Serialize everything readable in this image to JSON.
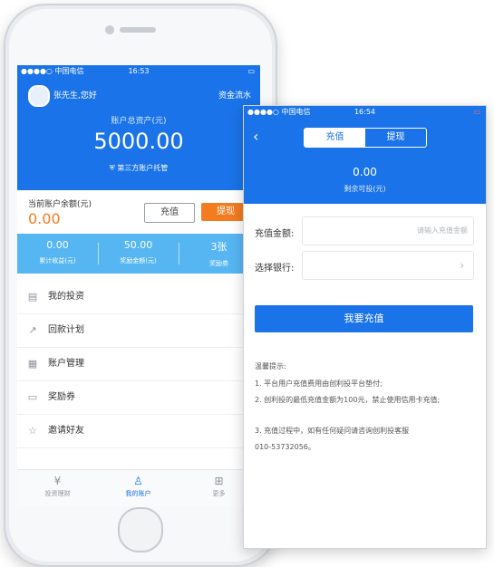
{
  "left_phone": {
    "status": {
      "carrier": "●●●●○ 中国电信",
      "time": "16:53",
      "battery": "▬"
    },
    "header": {
      "greeting": "张先生,您好",
      "fund_flow": "资金流水",
      "total_label": "账户总资产(元)",
      "total_value": "5000.00",
      "trustee": "第三方账户托管"
    },
    "balance": {
      "label": "当前账户余额(元)",
      "value": "0.00"
    },
    "buttons": {
      "recharge": "充值",
      "withdraw": "提现"
    },
    "stats": [
      {
        "value": "0.00",
        "label": "累计收益(元)"
      },
      {
        "value": "50.00",
        "label": "奖励金额(元)"
      },
      {
        "value": "3张",
        "label": "奖励券"
      }
    ],
    "menu": [
      {
        "label": "我的投资",
        "icon": "investment-icon"
      },
      {
        "label": "回款计划",
        "icon": "plan-icon"
      },
      {
        "label": "账户管理",
        "icon": "account-icon"
      },
      {
        "label": "奖励券",
        "icon": "coupon-icon"
      },
      {
        "label": "邀请好友",
        "icon": "invite-icon"
      }
    ],
    "tabs": [
      {
        "label": "投资理财",
        "icon": "yen-icon"
      },
      {
        "label": "我的账户",
        "icon": "user-icon"
      },
      {
        "label": "更多",
        "icon": "grid-icon"
      }
    ]
  },
  "right_panel": {
    "status": {
      "carrier": "●●●●○ 中国电信",
      "time": "16:54"
    },
    "segments": {
      "recharge": "充值",
      "withdraw": "提现"
    },
    "amount": "0.00",
    "amount_label": "剩余可投(元)",
    "form": {
      "amount_label": "充值金额:",
      "amount_placeholder": "请输入充值金额",
      "bank_label": "选择银行:"
    },
    "submit": "我要充值",
    "tips": {
      "title": "温馨提示:",
      "items": [
        "1. 平台用户充值费用由创利投平台垫付;",
        "2. 创利投的最低充值金额为100元，禁止使用信用卡充值;",
        "3. 充值过程中，如有任何疑问请咨询创利投客服",
        "010-53732056。"
      ]
    }
  },
  "colors": {
    "primary": "#1a73e8",
    "accent": "#f47b20",
    "stats_bg": "#56b6f2"
  }
}
